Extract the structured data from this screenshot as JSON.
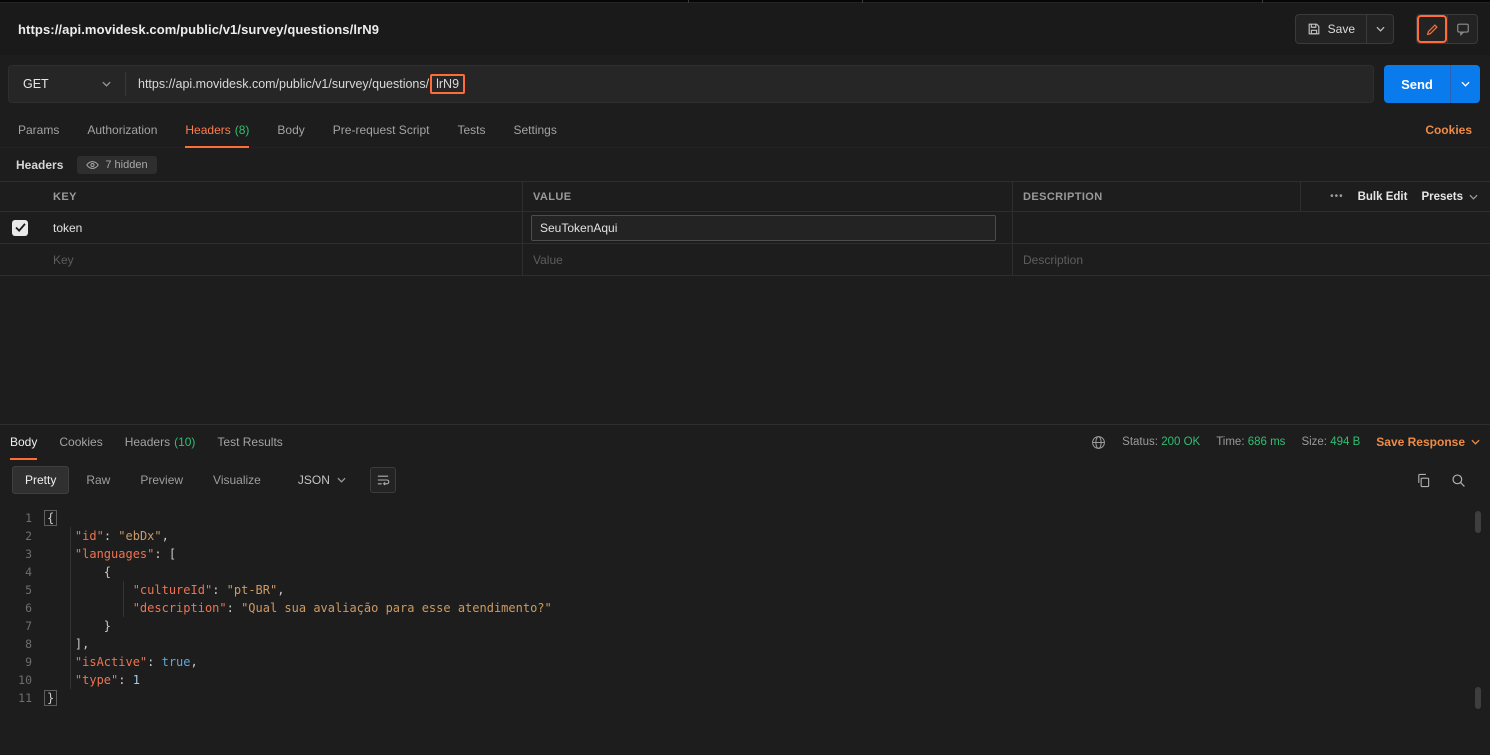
{
  "colors": {
    "accent_orange": "#ff6c37",
    "link_orange": "#ee8b47",
    "success_green": "#2fbf71",
    "send_blue": "#097bed"
  },
  "header": {
    "title": "https://api.movidesk.com/public/v1/survey/questions/lrN9",
    "save_label": "Save"
  },
  "request": {
    "method": "GET",
    "url_prefix": "https://api.movidesk.com/public/v1/survey/questions/",
    "url_highlight": "lrN9",
    "send_label": "Send"
  },
  "request_tabs": [
    {
      "label": "Params"
    },
    {
      "label": "Authorization"
    },
    {
      "label": "Headers",
      "count": "(8)",
      "active": true
    },
    {
      "label": "Body"
    },
    {
      "label": "Pre-request Script"
    },
    {
      "label": "Tests"
    },
    {
      "label": "Settings"
    }
  ],
  "cookies_link": "Cookies",
  "headers_section": {
    "title": "Headers",
    "hidden_badge": "7 hidden",
    "columns": [
      "KEY",
      "VALUE",
      "DESCRIPTION"
    ],
    "more_options_icon": "•••",
    "bulk_edit_label": "Bulk Edit",
    "presets_label": "Presets",
    "rows": [
      {
        "key": "token",
        "value": "SeuTokenAqui",
        "description": "",
        "checked": true
      }
    ],
    "placeholder_row": {
      "key": "Key",
      "value": "Value",
      "description": "Description"
    }
  },
  "response": {
    "tabs": [
      {
        "label": "Body",
        "active": true
      },
      {
        "label": "Cookies"
      },
      {
        "label": "Headers",
        "count": "(10)"
      },
      {
        "label": "Test Results"
      }
    ],
    "meta": {
      "status_label": "Status:",
      "status_value": "200 OK",
      "time_label": "Time:",
      "time_value": "686 ms",
      "size_label": "Size:",
      "size_value": "494 B",
      "save_response_label": "Save Response"
    },
    "view_tabs": [
      {
        "label": "Pretty",
        "active": true
      },
      {
        "label": "Raw"
      },
      {
        "label": "Preview"
      },
      {
        "label": "Visualize"
      }
    ],
    "format_select": "JSON",
    "code_lines": [
      {
        "n": 1,
        "tokens": [
          {
            "t": "pb",
            "v": "{"
          }
        ]
      },
      {
        "n": 2,
        "tokens": [
          {
            "t": "w",
            "v": "    "
          },
          {
            "t": "k",
            "v": "\"id\""
          },
          {
            "t": "p",
            "v": ": "
          },
          {
            "t": "s",
            "v": "\"ebDx\""
          },
          {
            "t": "p",
            "v": ","
          }
        ]
      },
      {
        "n": 3,
        "tokens": [
          {
            "t": "w",
            "v": "    "
          },
          {
            "t": "k",
            "v": "\"languages\""
          },
          {
            "t": "p",
            "v": ": ["
          }
        ]
      },
      {
        "n": 4,
        "tokens": [
          {
            "t": "w",
            "v": "        "
          },
          {
            "t": "p",
            "v": "{"
          }
        ]
      },
      {
        "n": 5,
        "tokens": [
          {
            "t": "w",
            "v": "            "
          },
          {
            "t": "k",
            "v": "\"cultureId\""
          },
          {
            "t": "p",
            "v": ": "
          },
          {
            "t": "s",
            "v": "\"pt-BR\""
          },
          {
            "t": "p",
            "v": ","
          }
        ]
      },
      {
        "n": 6,
        "tokens": [
          {
            "t": "w",
            "v": "            "
          },
          {
            "t": "k",
            "v": "\"description\""
          },
          {
            "t": "p",
            "v": ": "
          },
          {
            "t": "s",
            "v": "\"Qual sua avaliação para esse atendimento?\""
          }
        ]
      },
      {
        "n": 7,
        "tokens": [
          {
            "t": "w",
            "v": "        "
          },
          {
            "t": "p",
            "v": "}"
          }
        ]
      },
      {
        "n": 8,
        "tokens": [
          {
            "t": "w",
            "v": "    "
          },
          {
            "t": "p",
            "v": "],"
          }
        ]
      },
      {
        "n": 9,
        "tokens": [
          {
            "t": "w",
            "v": "    "
          },
          {
            "t": "k",
            "v": "\"isActive\""
          },
          {
            "t": "p",
            "v": ": "
          },
          {
            "t": "b",
            "v": "true"
          },
          {
            "t": "p",
            "v": ","
          }
        ]
      },
      {
        "n": 10,
        "tokens": [
          {
            "t": "w",
            "v": "    "
          },
          {
            "t": "k",
            "v": "\"type\""
          },
          {
            "t": "p",
            "v": ": "
          },
          {
            "t": "n",
            "v": "1"
          }
        ]
      },
      {
        "n": 11,
        "tokens": [
          {
            "t": "pb",
            "v": "}"
          }
        ]
      }
    ]
  }
}
